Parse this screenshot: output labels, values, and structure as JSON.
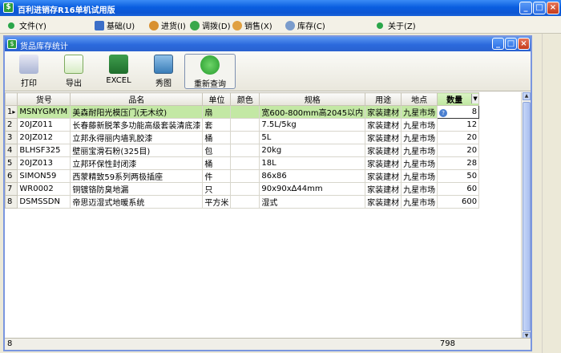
{
  "app": {
    "title": "百利进销存R16单机试用版",
    "icon": "app-logo-icon"
  },
  "menu": [
    {
      "label": "文件(Y)",
      "icon": "green-dot-icon"
    },
    {
      "label": "基础(U)",
      "icon": "list-icon"
    },
    {
      "label": "进货(I)",
      "icon": "people-icon"
    },
    {
      "label": "调拨(D)",
      "icon": "refresh-icon"
    },
    {
      "label": "销售(X)",
      "icon": "users-icon"
    },
    {
      "label": "库存(C)",
      "icon": "search-icon"
    },
    {
      "label": "关于(Z)",
      "icon": "green-dot-icon"
    }
  ],
  "window": {
    "title": "货品库存统计"
  },
  "toolbar": {
    "print": "打印",
    "export": "导出",
    "excel": "EXCEL",
    "chart": "秀图",
    "requery": "重新查询"
  },
  "table": {
    "columns": [
      "货号",
      "品名",
      "单位",
      "颜色",
      "规格",
      "用途",
      "地点",
      "数量"
    ],
    "rows": [
      {
        "n": "1",
        "code": "MSNYGMYM",
        "name": "美森耐阳光模压门(无木纹)",
        "unit": "扇",
        "color": "",
        "spec": "宽600-800mm高2045以内",
        "use": "家装建材",
        "place": "九星市场",
        "qty": "8"
      },
      {
        "n": "2",
        "code": "20JZ011",
        "name": "长春藤新脱苯多功能高级套装清底漆",
        "unit": "套",
        "color": "",
        "spec": "7.5L/5kg",
        "use": "家装建材",
        "place": "九星市场",
        "qty": "12"
      },
      {
        "n": "3",
        "code": "20JZ012",
        "name": "立邦永得丽内墙乳胶漆",
        "unit": "桶",
        "color": "",
        "spec": "5L",
        "use": "家装建材",
        "place": "九星市场",
        "qty": "20"
      },
      {
        "n": "4",
        "code": "BLHSF325",
        "name": "壁丽宝滑石粉(325目)",
        "unit": "包",
        "color": "",
        "spec": "20kg",
        "use": "家装建材",
        "place": "九星市场",
        "qty": "20"
      },
      {
        "n": "5",
        "code": "20JZ013",
        "name": "立邦环保性封闭漆",
        "unit": "桶",
        "color": "",
        "spec": "18L",
        "use": "家装建材",
        "place": "九星市场",
        "qty": "28"
      },
      {
        "n": "6",
        "code": "SIMON59",
        "name": "西蒙精致59系列两极插座",
        "unit": "件",
        "color": "",
        "spec": "86x86",
        "use": "家装建材",
        "place": "九星市场",
        "qty": "50"
      },
      {
        "n": "7",
        "code": "WR0002",
        "name": "铜镀铬防臭地漏",
        "unit": "只",
        "color": "",
        "spec": "90x90x∆44mm",
        "use": "家装建材",
        "place": "九星市场",
        "qty": "60"
      },
      {
        "n": "8",
        "code": "DSMSSDN",
        "name": "帝思迈湿式地暖系统",
        "unit": "平方米",
        "color": "",
        "spec": "湿式",
        "use": "家装建材",
        "place": "九星市场",
        "qty": "600"
      }
    ]
  },
  "footer": {
    "count": "8",
    "total": "798"
  }
}
